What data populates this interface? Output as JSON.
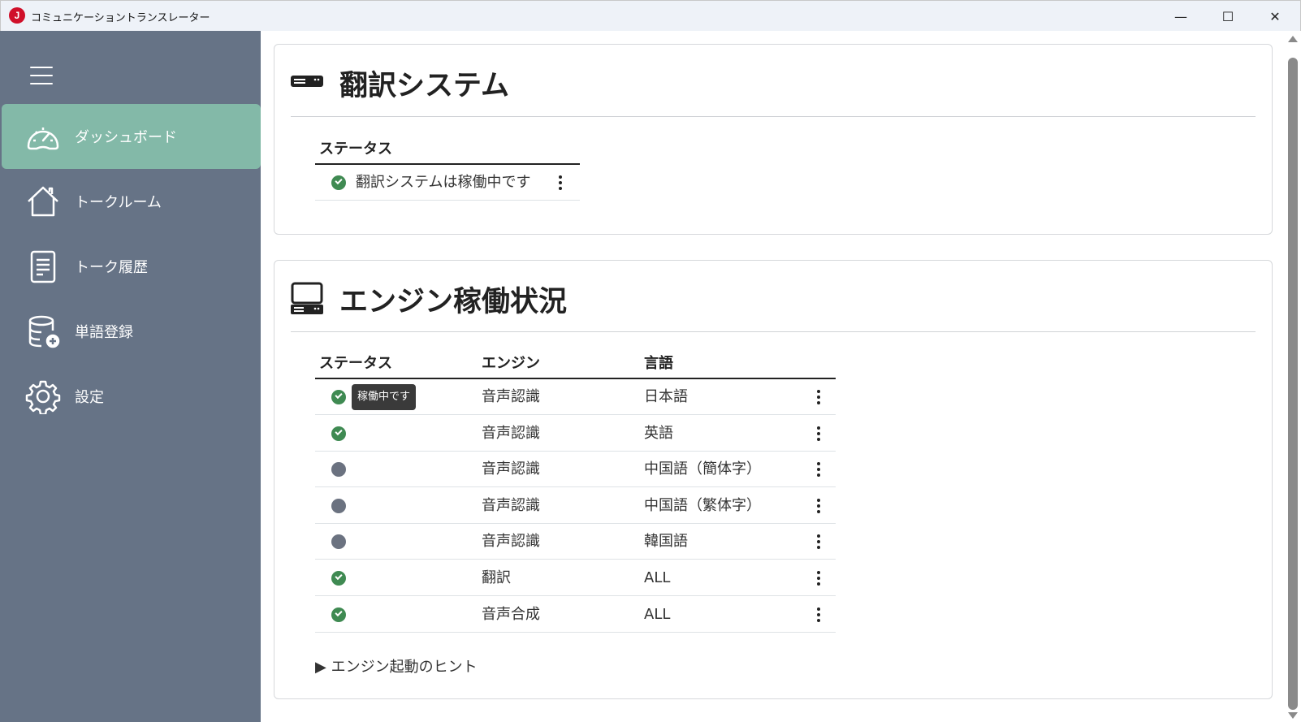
{
  "window": {
    "title": "コミュニケーショントランスレーター",
    "app_icon": "J",
    "minimize": "—",
    "maximize": "☐",
    "close": "✕"
  },
  "sidebar": {
    "items": [
      {
        "label": "ダッシュボード",
        "icon": "dashboard-gauge-icon",
        "active": true
      },
      {
        "label": "トークルーム",
        "icon": "house-icon"
      },
      {
        "label": "トーク履歴",
        "icon": "document-icon"
      },
      {
        "label": "単語登録",
        "icon": "database-add-icon"
      },
      {
        "label": "設定",
        "icon": "gear-icon"
      }
    ]
  },
  "translation_system": {
    "title": "翻訳システム",
    "header_status": "ステータス",
    "status_text": "翻訳システムは稼働中です"
  },
  "engine_status": {
    "title": "エンジン稼働状況",
    "headers": {
      "status": "ステータス",
      "engine": "エンジン",
      "language": "言語"
    },
    "tooltip": "稼働中です",
    "rows": [
      {
        "running": true,
        "engine": "音声認識",
        "language": "日本語"
      },
      {
        "running": true,
        "engine": "音声認識",
        "language": "英語"
      },
      {
        "running": false,
        "engine": "音声認識",
        "language": "中国語（簡体字）"
      },
      {
        "running": false,
        "engine": "音声認識",
        "language": "中国語（繁体字）"
      },
      {
        "running": false,
        "engine": "音声認識",
        "language": "韓国語"
      },
      {
        "running": true,
        "engine": "翻訳",
        "language": "ALL"
      },
      {
        "running": true,
        "engine": "音声合成",
        "language": "ALL"
      }
    ],
    "hint": "▶ エンジン起動のヒント"
  },
  "colors": {
    "sidebar": "#667386",
    "active": "#83b9a8",
    "running": "#3f8a52",
    "stopped": "#6b7280"
  }
}
